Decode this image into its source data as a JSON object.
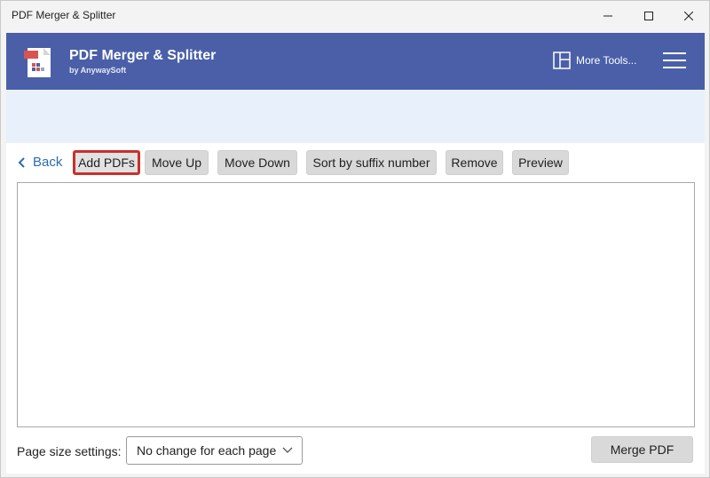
{
  "window": {
    "title": "PDF Merger & Splitter"
  },
  "header": {
    "app_name": "PDF Merger & Splitter",
    "subtitle": "by AnywaySoft",
    "more_tools_label": "More Tools...",
    "background_color": "#4a5fa8"
  },
  "toolbar": {
    "back_label": "Back",
    "buttons": [
      {
        "label": "Add PDFs",
        "selected": true
      },
      {
        "label": "Move Up"
      },
      {
        "label": "Move Down"
      },
      {
        "label": "Sort by suffix number"
      },
      {
        "label": "Remove"
      },
      {
        "label": "Preview"
      }
    ],
    "highlight_color": "#c9302c"
  },
  "footer": {
    "page_size_label": "Page size settings:",
    "page_size_value": "No change for each page",
    "merge_label": "Merge PDF"
  },
  "icons": {
    "logo": "pdf-logo-icon",
    "more_tools": "grid-layout-icon",
    "menu": "hamburger-menu-icon",
    "back": "chevron-left-icon",
    "select": "chevron-down-icon"
  }
}
